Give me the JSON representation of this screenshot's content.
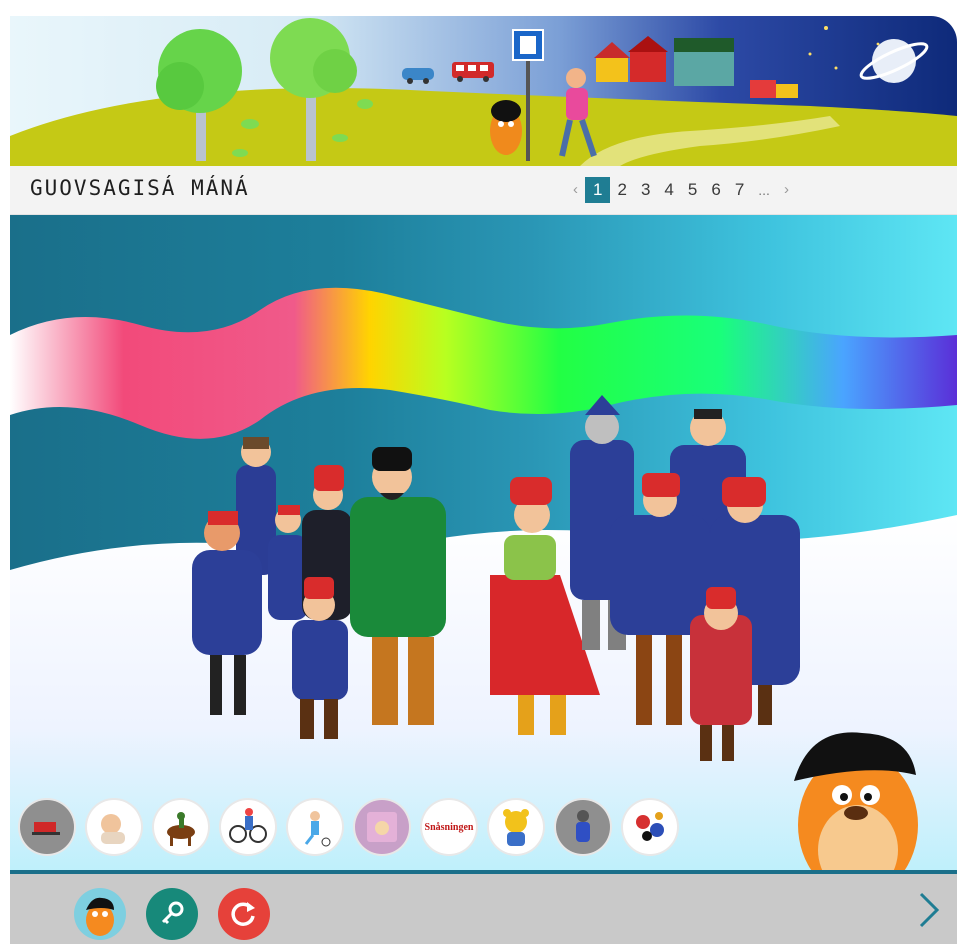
{
  "header": {
    "title": "GUOVSAGISÁ MÁNÁ",
    "icons": [
      "tree-icon",
      "tree-icon",
      "car-icon",
      "bus-icon",
      "school-sign-icon",
      "houses-icon",
      "planet-icon"
    ]
  },
  "pagination": {
    "prev_label": "‹",
    "pages": [
      "1",
      "2",
      "3",
      "4",
      "5",
      "6",
      "7"
    ],
    "active_page": "1",
    "ellipsis": "...",
    "next_label": "›"
  },
  "thumbnails": [
    {
      "name": "thumb-sled-icon"
    },
    {
      "name": "thumb-baby-icon"
    },
    {
      "name": "thumb-horse-rider-icon"
    },
    {
      "name": "thumb-cyclist-icon"
    },
    {
      "name": "thumb-football-icon"
    },
    {
      "name": "thumb-book-icon"
    },
    {
      "name": "thumb-snasningen",
      "label": "Snåsningen"
    },
    {
      "name": "thumb-bear-icon"
    },
    {
      "name": "thumb-child-snow-icon"
    },
    {
      "name": "thumb-cartoon-icon"
    }
  ],
  "footer": {
    "buttons": [
      "mascot-avatar",
      "key-button",
      "refresh-button"
    ],
    "next": "chevron-right-icon"
  },
  "colors": {
    "accent": "#1f7d93",
    "key_button": "#17897a",
    "refresh_button": "#e6413a",
    "next_arrow": "#1f7d93"
  }
}
